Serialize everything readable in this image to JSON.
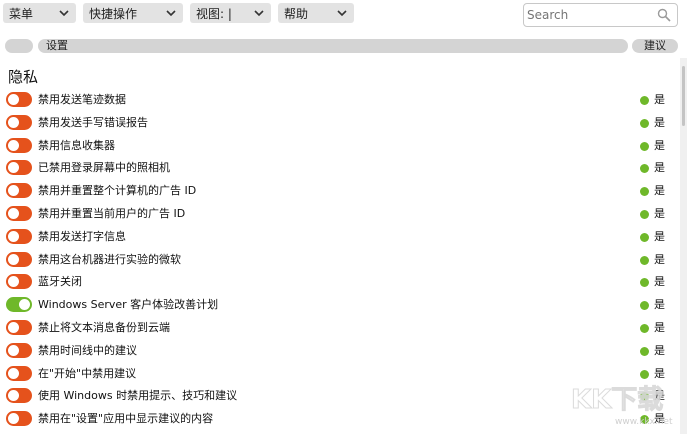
{
  "toolbar": {
    "menus": [
      {
        "label": "菜单"
      },
      {
        "label": "快捷操作"
      },
      {
        "label": "视图: |"
      },
      {
        "label": "帮助"
      }
    ],
    "search": {
      "placeholder": "Search"
    }
  },
  "table_header": {
    "settings_label": "设置",
    "suggestion_label": "建议"
  },
  "section": {
    "title": "隐私"
  },
  "colors": {
    "off": "#e5521c",
    "on": "#6fb82a",
    "suggest_dot": "#6fb82a"
  },
  "rows": [
    {
      "label": "禁用发送笔迹数据",
      "state": "off",
      "suggestion": "是"
    },
    {
      "label": "禁用发送手写错误报告",
      "state": "off",
      "suggestion": "是"
    },
    {
      "label": "禁用信息收集器",
      "state": "off",
      "suggestion": "是"
    },
    {
      "label": "已禁用登录屏幕中的照相机",
      "state": "off",
      "suggestion": "是"
    },
    {
      "label": "禁用并重置整个计算机的广告 ID",
      "state": "off",
      "suggestion": "是"
    },
    {
      "label": "禁用并重置当前用户的广告 ID",
      "state": "off",
      "suggestion": "是"
    },
    {
      "label": "禁用发送打字信息",
      "state": "off",
      "suggestion": "是"
    },
    {
      "label": "禁用这台机器进行实验的微软",
      "state": "off",
      "suggestion": "是"
    },
    {
      "label": "蓝牙关闭",
      "state": "off",
      "suggestion": "是"
    },
    {
      "label": "Windows Server 客户体验改善计划",
      "state": "on",
      "suggestion": "是"
    },
    {
      "label": "禁止将文本消息备份到云端",
      "state": "off",
      "suggestion": "是"
    },
    {
      "label": "禁用时间线中的建议",
      "state": "off",
      "suggestion": "是"
    },
    {
      "label": "在\"开始\"中禁用建议",
      "state": "off",
      "suggestion": "是"
    },
    {
      "label": "使用 Windows 时禁用提示、技巧和建议",
      "state": "off",
      "suggestion": "是"
    },
    {
      "label": "禁用在\"设置\"应用中显示建议的内容",
      "state": "off",
      "suggestion": "是"
    }
  ],
  "watermark": {
    "brand": "KK下载",
    "url": "www.kkx.net"
  }
}
